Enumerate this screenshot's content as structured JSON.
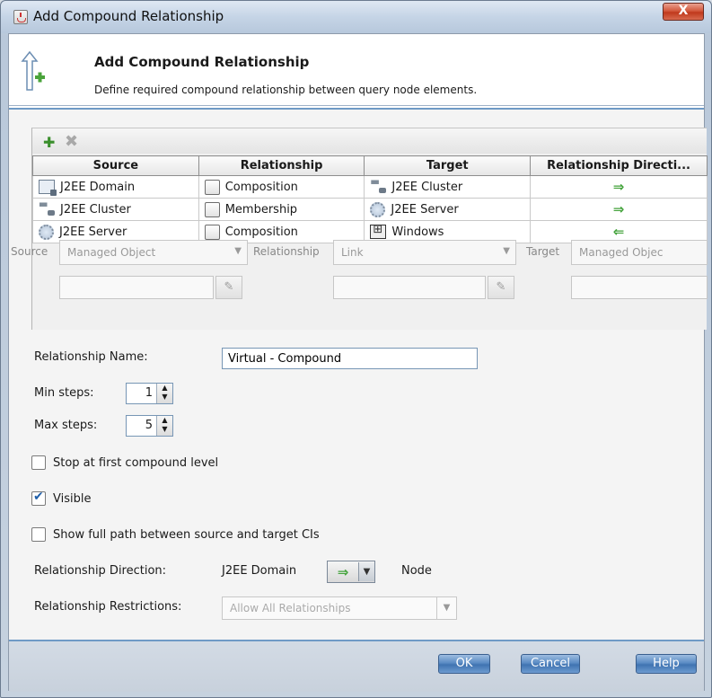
{
  "window": {
    "title": "Add Compound Relationship",
    "close_label": "X"
  },
  "header": {
    "title": "Add Compound Relationship",
    "description": "Define required compound relationship between query node elements."
  },
  "grid": {
    "columns": [
      "Source",
      "Relationship",
      "Target",
      "Relationship Directi..."
    ],
    "rows": [
      {
        "source": "J2EE Domain",
        "source_icon": "j2ee-domain-icon",
        "relationship": "Composition",
        "target": "J2EE Cluster",
        "target_icon": "j2ee-cluster-icon",
        "direction": "⇒",
        "direction_name": "right-arrow-icon"
      },
      {
        "source": "J2EE Cluster",
        "source_icon": "j2ee-cluster-icon",
        "relationship": "Membership",
        "target": "J2EE Server",
        "target_icon": "j2ee-server-icon",
        "direction": "⇒",
        "direction_name": "right-arrow-icon"
      },
      {
        "source": "J2EE Server",
        "source_icon": "j2ee-server-icon",
        "relationship": "Composition",
        "target": "Windows",
        "target_icon": "windows-icon",
        "direction": "⇐",
        "direction_name": "left-arrow-icon"
      }
    ]
  },
  "filter": {
    "source_label": "Source",
    "source_value": "Managed Object",
    "relationship_label": "Relationship",
    "relationship_value": "Link",
    "target_label": "Target",
    "target_value": "Managed Objec"
  },
  "form": {
    "relationship_name_label": "Relationship Name:",
    "relationship_name_value": "Virtual - Compound",
    "min_steps_label": "Min steps:",
    "min_steps_value": "1",
    "max_steps_label": "Max steps:",
    "max_steps_value": "5",
    "stop_first_label": "Stop at first compound level",
    "visible_label": "Visible",
    "show_full_path_label": "Show full path between source and target CIs",
    "direction_label": "Relationship Direction:",
    "direction_source": "J2EE Domain",
    "direction_target": "Node",
    "restrictions_label": "Relationship Restrictions:",
    "restrictions_value": "Allow All Relationships"
  },
  "footer": {
    "ok": "OK",
    "cancel": "Cancel",
    "help": "Help"
  }
}
